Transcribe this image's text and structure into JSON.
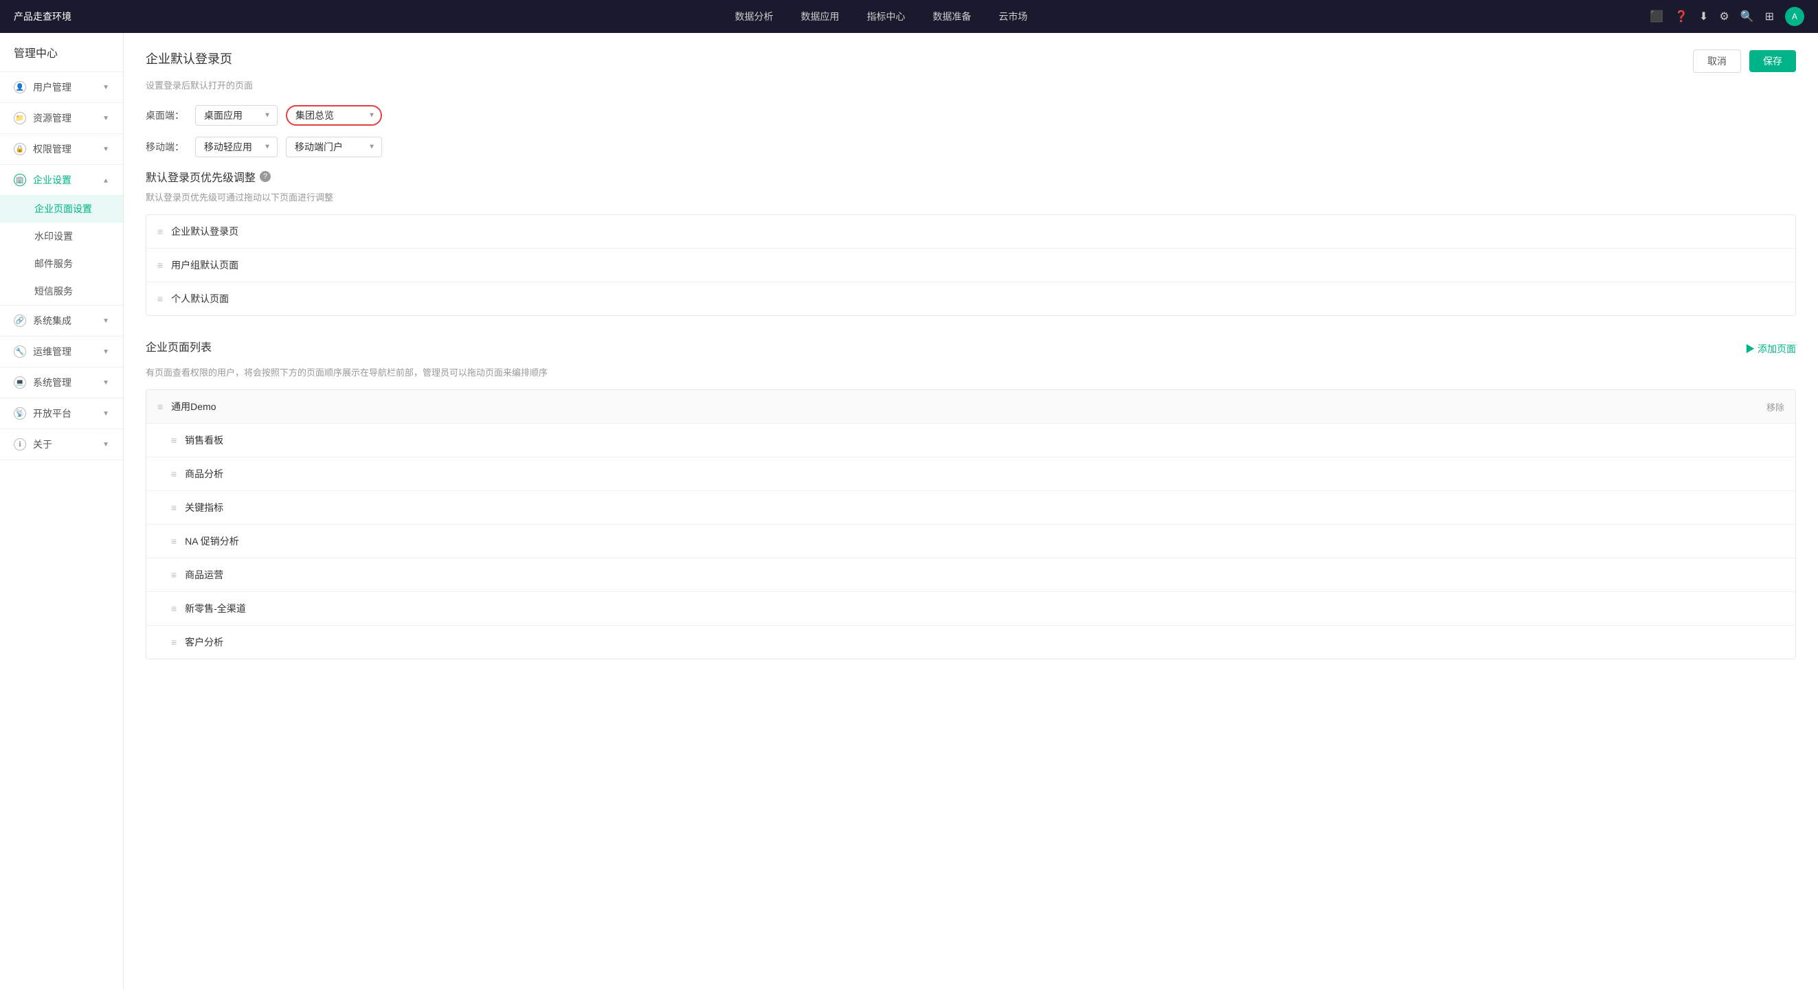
{
  "app": {
    "brand": "产品走查环境"
  },
  "topnav": {
    "items": [
      {
        "id": "data-analysis",
        "label": "数据分析"
      },
      {
        "id": "data-app",
        "label": "数据应用"
      },
      {
        "id": "metrics",
        "label": "指标中心"
      },
      {
        "id": "data-prep",
        "label": "数据准备"
      },
      {
        "id": "cloud-market",
        "label": "云市场"
      }
    ]
  },
  "sidebar": {
    "title": "管理中心",
    "groups": [
      {
        "id": "user-mgmt",
        "label": "用户管理",
        "icon": "user-icon",
        "expanded": false
      },
      {
        "id": "resource-mgmt",
        "label": "资源管理",
        "icon": "resource-icon",
        "expanded": false
      },
      {
        "id": "permission-mgmt",
        "label": "权限管理",
        "icon": "permission-icon",
        "expanded": false
      },
      {
        "id": "enterprise-settings",
        "label": "企业设置",
        "icon": "enterprise-icon",
        "expanded": true,
        "children": [
          {
            "id": "enterprise-page-settings",
            "label": "企业页面设置",
            "active": true
          },
          {
            "id": "watermark-settings",
            "label": "水印设置",
            "active": false
          },
          {
            "id": "email-service",
            "label": "邮件服务",
            "active": false
          },
          {
            "id": "sms-service",
            "label": "短信服务",
            "active": false
          }
        ]
      },
      {
        "id": "system-integration",
        "label": "系统集成",
        "icon": "integration-icon",
        "expanded": false
      },
      {
        "id": "ops-mgmt",
        "label": "运维管理",
        "icon": "ops-icon",
        "expanded": false
      },
      {
        "id": "system-mgmt",
        "label": "系统管理",
        "icon": "system-icon",
        "expanded": false
      },
      {
        "id": "open-platform",
        "label": "开放平台",
        "icon": "open-icon",
        "expanded": false
      },
      {
        "id": "about",
        "label": "关于",
        "icon": "about-icon",
        "expanded": false
      }
    ]
  },
  "main": {
    "page_title": "企业默认登录页",
    "page_subtitle": "设置登录后默认打开的页面",
    "cancel_btn": "取消",
    "save_btn": "保存",
    "desktop_label": "桌面端：",
    "desktop_app_option": "桌面应用",
    "desktop_page_option": "集团总览",
    "mobile_label": "移动端：",
    "mobile_app_option": "移动轻应用",
    "mobile_page_option": "移动端门户",
    "priority_section": {
      "title": "默认登录页优先级调整",
      "tooltip": "?",
      "subtitle": "默认登录页优先级可通过拖动以下页面进行调整",
      "items": [
        {
          "id": "enterprise-default",
          "label": "企业默认登录页"
        },
        {
          "id": "user-group-default",
          "label": "用户组默认页面"
        },
        {
          "id": "personal-default",
          "label": "个人默认页面"
        }
      ]
    },
    "page_list_section": {
      "title": "企业页面列表",
      "add_btn": "▶ 添加页面",
      "subtitle": "有页面查看权限的用户，将会按照下方的页面顺序展示在导航栏前部，管理员可以拖动页面来编排顺序",
      "groups": [
        {
          "id": "general-demo",
          "name": "通用Demo",
          "remove_label": "移除",
          "pages": [
            {
              "id": "sales-dashboard",
              "name": "销售看板"
            },
            {
              "id": "product-analysis",
              "name": "商品分析"
            },
            {
              "id": "key-metrics",
              "name": "关键指标"
            },
            {
              "id": "na-promotion",
              "name": "NA 促销分析"
            },
            {
              "id": "product-ops",
              "name": "商品运营"
            },
            {
              "id": "new-retail",
              "name": "新零售-全渠道"
            },
            {
              "id": "customer-analysis",
              "name": "客户分析"
            }
          ]
        }
      ]
    }
  }
}
